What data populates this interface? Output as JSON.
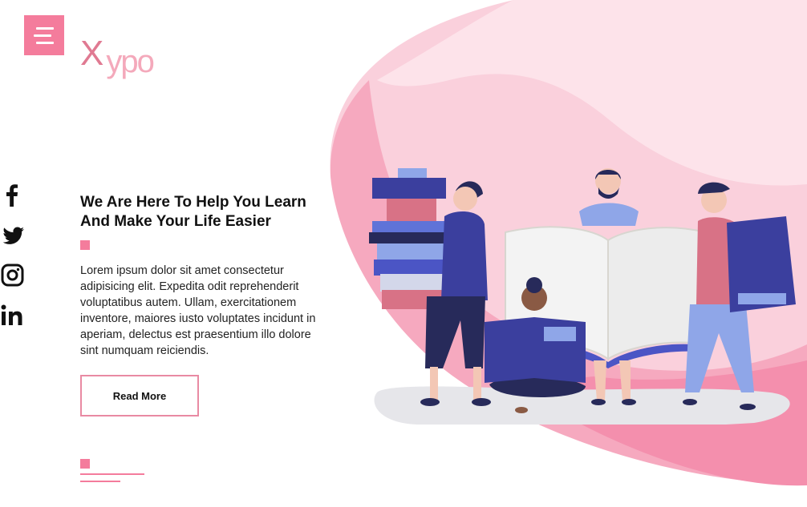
{
  "brand": {
    "logo_x": "X",
    "logo_rest": "ypo"
  },
  "menu": {
    "icon": "hamburger-icon"
  },
  "social": [
    {
      "name": "facebook",
      "icon": "facebook-icon"
    },
    {
      "name": "twitter",
      "icon": "twitter-icon"
    },
    {
      "name": "instagram",
      "icon": "instagram-icon"
    },
    {
      "name": "linkedin",
      "icon": "linkedin-icon"
    }
  ],
  "hero": {
    "headline_line1": "We Are Here To Help You Learn",
    "headline_line2": "And Make Your Life Easier",
    "body": "Lorem ipsum dolor sit amet consectetur adipisicing elit. Expedita odit reprehenderit voluptatibus autem. Ullam, exercitationem inventore, maiores iusto voluptates incidunt in aperiam, delectus est praesentium illo dolore sint numquam reiciendis.",
    "cta_label": "Read More"
  },
  "colors": {
    "accent": "#f47c9c",
    "accent_light": "#ffd3de",
    "pink_mid": "#f6a2b8",
    "book_blue": "#3b3f9e"
  }
}
